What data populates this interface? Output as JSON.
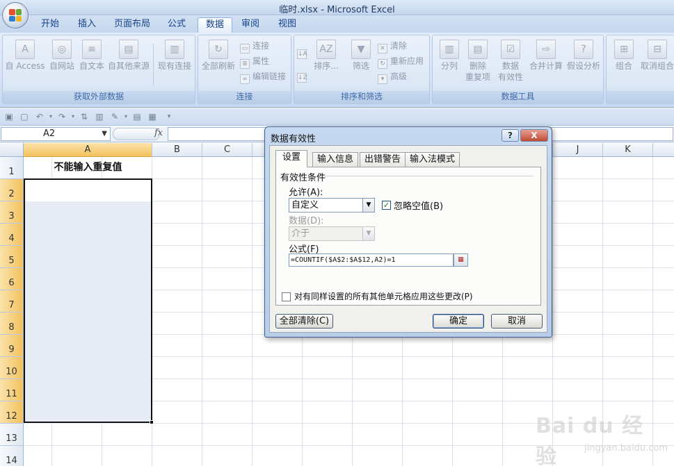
{
  "window": {
    "title": "临时.xlsx - Microsoft Excel"
  },
  "tabs": [
    "开始",
    "插入",
    "页面布局",
    "公式",
    "数据",
    "审阅",
    "视图"
  ],
  "active_tab": "数据",
  "ribbon": {
    "group_external": {
      "title": "获取外部数据",
      "buttons": [
        "自 Access",
        "自网站",
        "自文本",
        "自其他来源",
        "现有连接"
      ]
    },
    "group_connections": {
      "title": "连接",
      "refresh_all": "全部刷新",
      "small": [
        "连接",
        "属性",
        "编辑链接"
      ]
    },
    "group_sort": {
      "title": "排序和筛选",
      "sort": "排序...",
      "filter": "筛选",
      "small": [
        "清除",
        "重新应用",
        "高级"
      ]
    },
    "group_tools": {
      "title": "数据工具",
      "split": "分列",
      "remove_dup": [
        "删除",
        "重复项"
      ],
      "validation": [
        "数据",
        "有效性"
      ],
      "consolidate": "合并计算",
      "what_if": "假设分析"
    },
    "group_outline": {
      "group": "组合",
      "ungroup": "取消组合"
    }
  },
  "formula_bar": {
    "name_box": "A2",
    "fx": "fx",
    "formula": ""
  },
  "grid": {
    "columns": [
      "A",
      "B",
      "C",
      "D",
      "E",
      "F",
      "G",
      "H",
      "I",
      "J",
      "K"
    ],
    "rows": [
      "1",
      "2",
      "3",
      "4",
      "5",
      "6",
      "7",
      "8",
      "9",
      "10",
      "11",
      "12",
      "13",
      "14"
    ],
    "selected_column": "A",
    "cell_A1": "不能输入重复值"
  },
  "dialog": {
    "title": "数据有效性",
    "help": "?",
    "close": "X",
    "tabs": [
      "设置",
      "输入信息",
      "出错警告",
      "输入法模式"
    ],
    "active_tab": "设置",
    "section": "有效性条件",
    "allow_label": "允许(A):",
    "allow_value": "自定义",
    "ignore_blank_label": "忽略空值(B)",
    "ignore_blank_checked": true,
    "data_label": "数据(D):",
    "data_value": "介于",
    "formula_label": "公式(F)",
    "formula_value": "=COUNTIF($A$2:$A$12,A2)=1",
    "apply_all_label": "对有同样设置的所有其他单元格应用这些更改(P)",
    "apply_all_checked": false,
    "clear_all": "全部清除(C)",
    "ok": "确定",
    "cancel": "取消"
  },
  "watermark": {
    "main": "Bai du 经验",
    "sub": "jingyan.baidu.com"
  }
}
